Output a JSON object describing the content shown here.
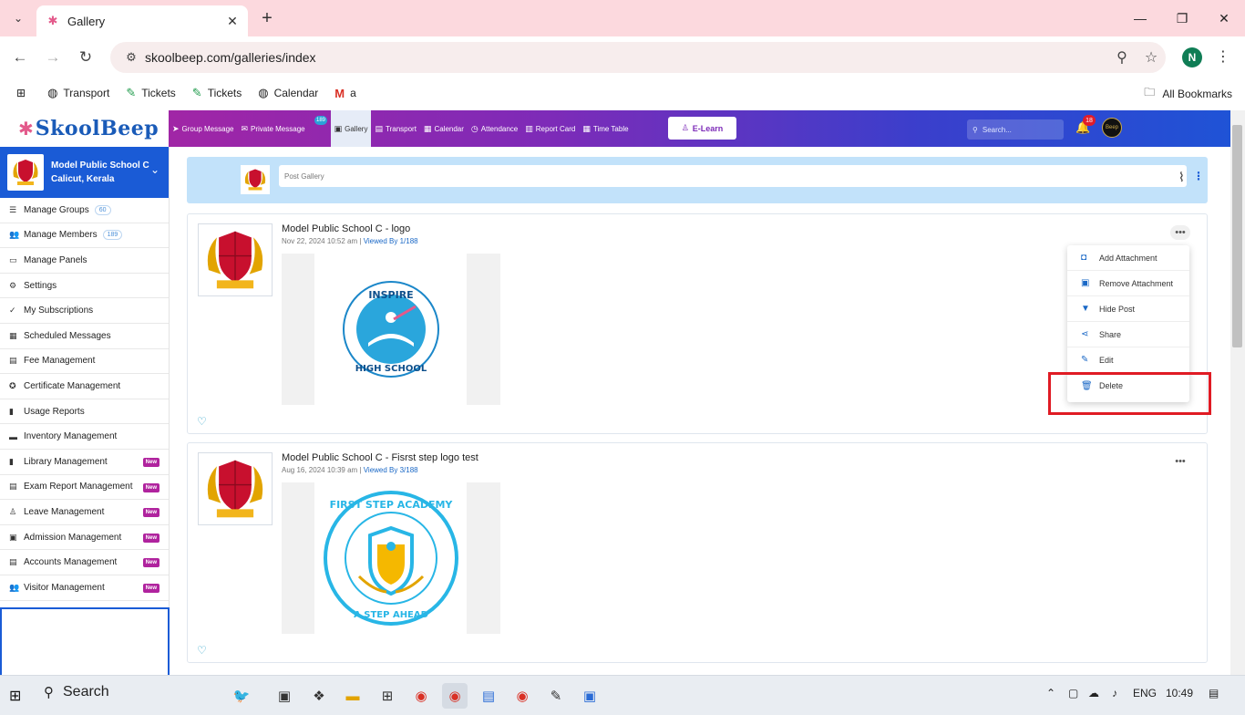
{
  "browser": {
    "tab_title": "Gallery",
    "url": "skoolbeep.com/galleries/index",
    "profile_initial": "N",
    "bookmarks": [
      "Transport",
      "Tickets",
      "Tickets",
      "Calendar",
      "a"
    ],
    "all_bookmarks": "All Bookmarks"
  },
  "header": {
    "logo": "SkoolBeep",
    "nav": [
      {
        "label": "Group Message",
        "icon": "send-icon"
      },
      {
        "label": "Private Message",
        "icon": "mail-icon"
      },
      {
        "label": "Gallery",
        "icon": "image-icon"
      },
      {
        "label": "Transport",
        "icon": "bus-icon"
      },
      {
        "label": "Calendar",
        "icon": "calendar-icon"
      },
      {
        "label": "Attendance",
        "icon": "clock-icon"
      },
      {
        "label": "Report Card",
        "icon": "report-icon"
      },
      {
        "label": "Time Table",
        "icon": "timetable-icon"
      }
    ],
    "private_badge": "189",
    "elearn": "E-Learn",
    "search_placeholder": "Search...",
    "notif_count": "18",
    "avatar_text": "Beep"
  },
  "sidebar": {
    "school_name": "Model Public School C",
    "school_location": "Calicut, Kerala",
    "items": [
      {
        "label": "Manage Groups",
        "badge": "60",
        "new": false
      },
      {
        "label": "Manage Members",
        "badge": "189",
        "new": false
      },
      {
        "label": "Manage Panels",
        "badge": "",
        "new": false
      },
      {
        "label": "Settings",
        "badge": "",
        "new": false
      },
      {
        "label": "My Subscriptions",
        "badge": "",
        "new": false
      },
      {
        "label": "Scheduled Messages",
        "badge": "",
        "new": false
      },
      {
        "label": "Fee Management",
        "badge": "",
        "new": false
      },
      {
        "label": "Certificate Management",
        "badge": "",
        "new": false
      },
      {
        "label": "Usage Reports",
        "badge": "",
        "new": false
      },
      {
        "label": "Inventory Management",
        "badge": "",
        "new": false
      },
      {
        "label": "Library Management",
        "badge": "",
        "new": true
      },
      {
        "label": "Exam Report Management",
        "badge": "",
        "new": true
      },
      {
        "label": "Leave Management",
        "badge": "",
        "new": true
      },
      {
        "label": "Admission Management",
        "badge": "",
        "new": true
      },
      {
        "label": "Accounts Management",
        "badge": "",
        "new": true
      },
      {
        "label": "Visitor Management",
        "badge": "",
        "new": true
      }
    ],
    "new_label": "New"
  },
  "main": {
    "post_placeholder": "Post Gallery",
    "posts": [
      {
        "title": "Model Public School C - logo",
        "date": "Nov 22, 2024 10:52 am",
        "viewed": "Viewed By 1/188",
        "image_text_top": "INSPIRE",
        "image_text_bottom": "HIGH SCHOOL"
      },
      {
        "title": "Model Public School C - Fisrst step logo test",
        "date": "Aug 16, 2024 10:39 am",
        "viewed": "Viewed By 3/188",
        "image_text_top": "FIRST STEP ACADEMY",
        "image_text_bottom": "A STEP AHEAD"
      }
    ],
    "menu": [
      "Add Attachment",
      "Remove Attachment",
      "Hide Post",
      "Share",
      "Edit",
      "Delete"
    ]
  },
  "taskbar": {
    "search": "Search",
    "lang": "ENG",
    "time": "10:49"
  }
}
